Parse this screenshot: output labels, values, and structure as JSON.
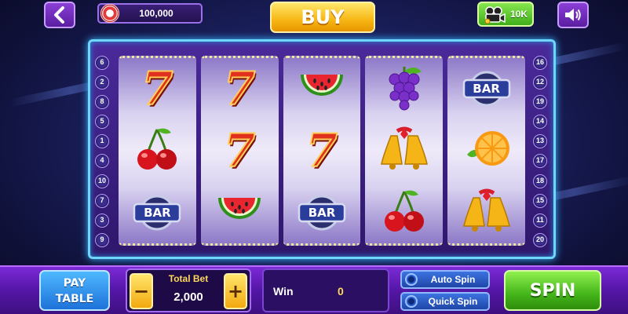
{
  "top_bar": {
    "coin_balance": "100,000",
    "buy_label": "BUY",
    "video_reward": "10K"
  },
  "paylines": {
    "left": [
      "6",
      "2",
      "8",
      "5",
      "1",
      "4",
      "10",
      "7",
      "3",
      "9"
    ],
    "right": [
      "16",
      "12",
      "19",
      "14",
      "13",
      "17",
      "18",
      "15",
      "11",
      "20"
    ]
  },
  "reels": [
    [
      "seven",
      "cherry",
      "bar"
    ],
    [
      "seven",
      "seven",
      "watermelon"
    ],
    [
      "watermelon",
      "seven",
      "bar"
    ],
    [
      "grapes",
      "bell",
      "cherry"
    ],
    [
      "bar",
      "orange",
      "bell"
    ]
  ],
  "symbol_labels": {
    "bar": "BAR",
    "seven": "7"
  },
  "bottom_bar": {
    "pay_table_line1": "PAY",
    "pay_table_line2": "TABLE",
    "total_bet_label": "Total Bet",
    "total_bet_value": "2,000",
    "minus_label": "−",
    "plus_label": "+",
    "win_label": "Win",
    "win_value": "0",
    "auto_spin_label": "Auto Spin",
    "quick_spin_label": "Quick Spin",
    "spin_label": "SPIN"
  },
  "colors": {
    "frame": "#6fd6ff",
    "accent_gold": "#f7b614",
    "accent_green": "#44b51a",
    "panel_purple": "#5416a6"
  }
}
